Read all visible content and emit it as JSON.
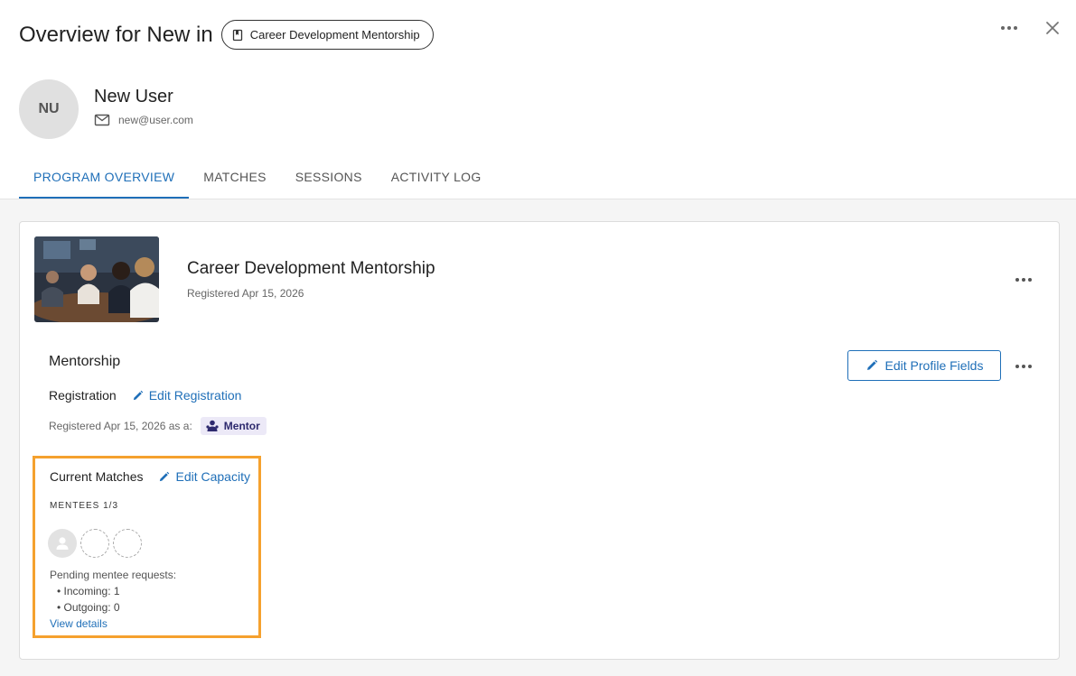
{
  "header": {
    "title": "Overview for New in",
    "program_chip": "Career Development Mentorship",
    "more_icon": "more-horizontal-icon",
    "close_icon": "close-icon"
  },
  "user": {
    "initials": "NU",
    "name": "New User",
    "email": "new@user.com"
  },
  "tabs": [
    {
      "label": "PROGRAM OVERVIEW",
      "active": true
    },
    {
      "label": "MATCHES",
      "active": false
    },
    {
      "label": "SESSIONS",
      "active": false
    },
    {
      "label": "ACTIVITY LOG",
      "active": false
    }
  ],
  "program": {
    "title": "Career Development Mentorship",
    "registered": "Registered Apr 15, 2026"
  },
  "mentorship": {
    "section_title": "Mentorship",
    "edit_profile_label": "Edit Profile Fields",
    "registration_label": "Registration",
    "edit_registration_label": "Edit Registration",
    "registered_as": "Registered Apr 15, 2026 as a:",
    "role": "Mentor"
  },
  "matches": {
    "title": "Current Matches",
    "edit_capacity_label": "Edit Capacity",
    "mentees_count": "MENTEES 1/3",
    "filled_slots": 1,
    "total_slots": 3,
    "pending_title": "Pending mentee requests:",
    "incoming": "• Incoming: 1",
    "outgoing": "• Outgoing: 0",
    "view_details": "View details"
  },
  "colors": {
    "accent": "#1f6fb8",
    "highlight": "#f5a12e",
    "role_badge_bg": "#ece9f7"
  }
}
